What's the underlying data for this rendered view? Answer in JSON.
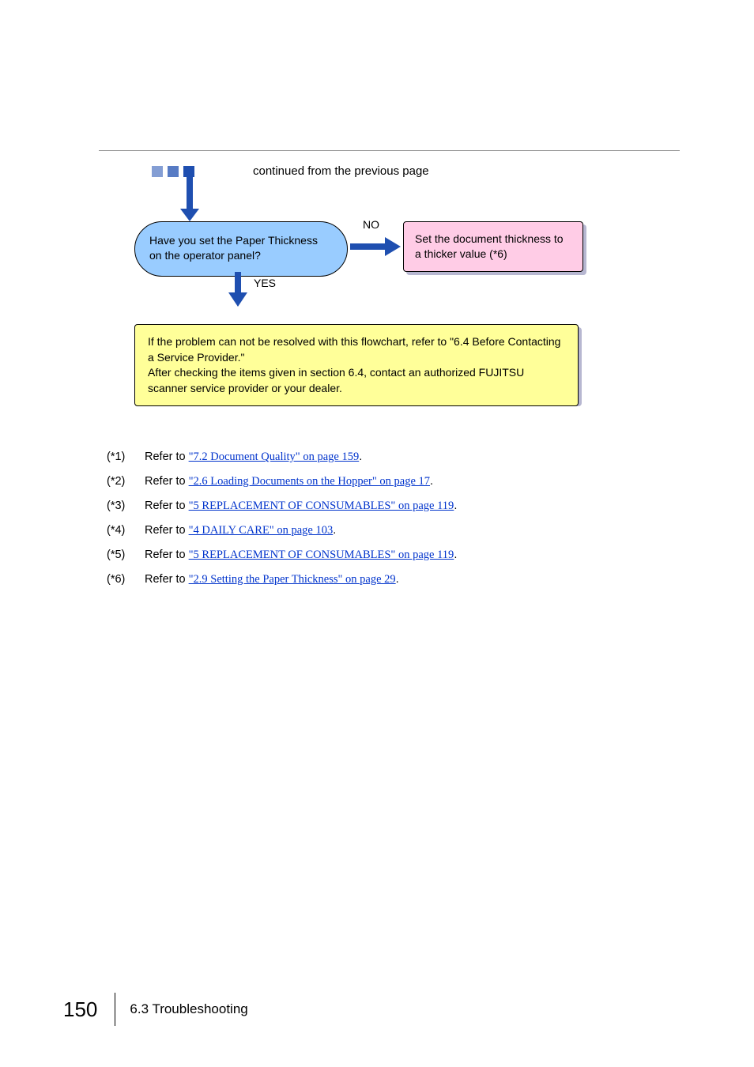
{
  "continuation_label": "continued from the previous page",
  "decision": {
    "text": "Have you set the Paper Thickness on the operator panel?",
    "no_label": "NO",
    "yes_label": "YES"
  },
  "action": {
    "text": "Set the document thickness to a thicker value (*6)"
  },
  "final": {
    "line1": "If the problem can not be resolved with this flowchart, refer to \"6.4 Before Contacting a Service Provider.\"",
    "line2": "After checking the items given in section 6.4, contact an authorized FUJITSU scanner service provider or your dealer."
  },
  "refs": [
    {
      "key": "(*1)",
      "prefix": "Refer to ",
      "link": "\"7.2 Document Quality\" on page 159",
      "suffix": "."
    },
    {
      "key": "(*2)",
      "prefix": "Refer to ",
      "link": "\"2.6 Loading Documents on the Hopper\" on page 17",
      "suffix": "."
    },
    {
      "key": "(*3)",
      "prefix": "Refer to ",
      "link": "\"5 REPLACEMENT OF CONSUMABLES\" on page 119",
      "suffix": "."
    },
    {
      "key": "(*4)",
      "prefix": "Refer to ",
      "link": "\"4  DAILY CARE\" on page 103",
      "suffix": "."
    },
    {
      "key": "(*5)",
      "prefix": "Refer to ",
      "link": "\"5 REPLACEMENT OF CONSUMABLES\" on page 119",
      "suffix": "."
    },
    {
      "key": "(*6)",
      "prefix": "Refer to ",
      "link": "\"2.9 Setting the Paper Thickness\" on page 29",
      "suffix": "."
    }
  ],
  "footer": {
    "page": "150",
    "section": "6.3 Troubleshooting"
  }
}
